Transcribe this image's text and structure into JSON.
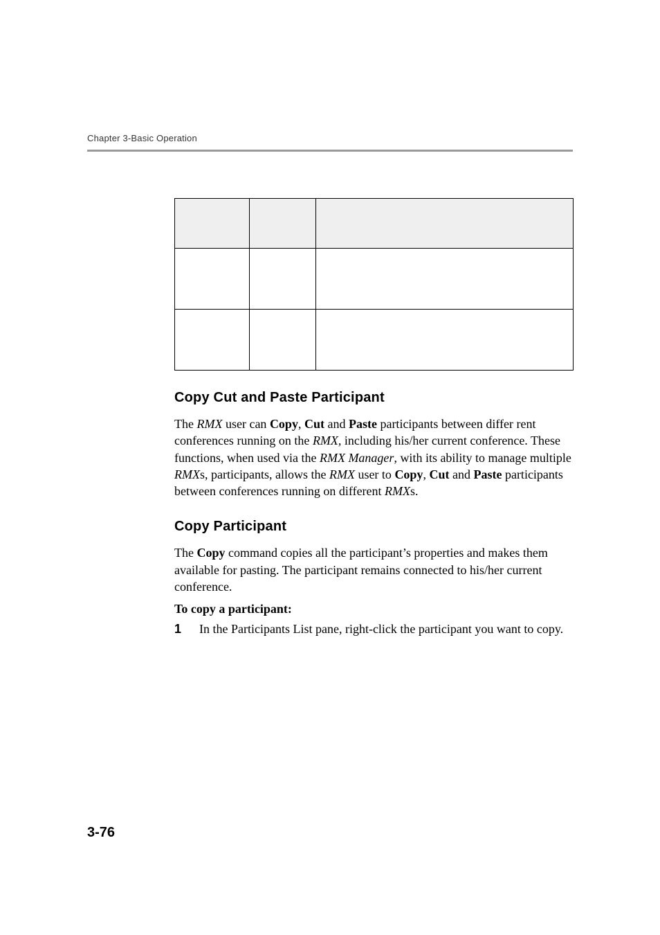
{
  "running_head": "Chapter 3-Basic Operation",
  "page_number": "3-76",
  "table": {
    "headers": [
      "",
      "",
      ""
    ],
    "rows": [
      [
        "",
        "",
        ""
      ],
      [
        "",
        "",
        ""
      ]
    ]
  },
  "sections": {
    "s1": {
      "title": "Copy Cut and Paste Participant",
      "para_parts": [
        {
          "t": "The ",
          "c": ""
        },
        {
          "t": "RMX",
          "c": "i"
        },
        {
          "t": " user can ",
          "c": ""
        },
        {
          "t": "Copy",
          "c": "b"
        },
        {
          "t": ", ",
          "c": ""
        },
        {
          "t": "Cut",
          "c": "b"
        },
        {
          "t": " and ",
          "c": ""
        },
        {
          "t": "Paste",
          "c": "b"
        },
        {
          "t": " participants between differ rent conferences running on the ",
          "c": ""
        },
        {
          "t": "RMX,",
          "c": "i"
        },
        {
          "t": " including his/her current conference. These functions, when used via the ",
          "c": ""
        },
        {
          "t": "RMX Manager",
          "c": "i"
        },
        {
          "t": ", with its ability to manage multiple ",
          "c": ""
        },
        {
          "t": "RMX",
          "c": "i"
        },
        {
          "t": "s, participants, allows the ",
          "c": ""
        },
        {
          "t": "RMX",
          "c": "i"
        },
        {
          "t": " user to ",
          "c": ""
        },
        {
          "t": "Copy",
          "c": "b"
        },
        {
          "t": ", ",
          "c": ""
        },
        {
          "t": "Cut",
          "c": "b"
        },
        {
          "t": " and ",
          "c": ""
        },
        {
          "t": "Paste",
          "c": "b"
        },
        {
          "t": " participants between conferences running on different ",
          "c": ""
        },
        {
          "t": "RMX",
          "c": "i"
        },
        {
          "t": "s.",
          "c": ""
        }
      ]
    },
    "s2": {
      "title": "Copy Participant",
      "para_parts": [
        {
          "t": "The ",
          "c": ""
        },
        {
          "t": "Copy",
          "c": "b"
        },
        {
          "t": " command copies all the participant’s properties and makes them available for pasting. The participant remains connected to his/her current conference.",
          "c": ""
        }
      ],
      "lead": "To copy a participant:",
      "step_num": "1",
      "step_parts": [
        {
          "t": "In the ",
          "c": ""
        },
        {
          "t": "Participants List",
          "c": "i"
        },
        {
          "t": " pane, right-click the participant you want to copy.",
          "c": ""
        }
      ]
    }
  }
}
